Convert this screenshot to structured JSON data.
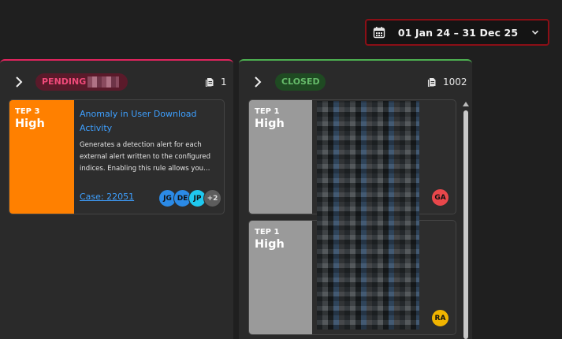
{
  "date_range": {
    "label": "01 Jan 24 – 31 Dec 25",
    "icon": "calendar-icon"
  },
  "columns": [
    {
      "status": "PENDING",
      "accent": "#e0245e",
      "count": "1",
      "cards": [
        {
          "step": "TEP 3",
          "severity": "High",
          "severity_color": "#ff8000",
          "title": "Anomaly in User Download Activity",
          "description": "Generates a detection alert for each external alert written to the configured indices. Enabling this rule allows you…",
          "case": "Case: 22051",
          "assignees": [
            "JG",
            "DE",
            "JP"
          ],
          "more_assignees": "+2"
        }
      ]
    },
    {
      "status": "CLOSED",
      "accent": "#4caf50",
      "count": "1002",
      "cards": [
        {
          "step": "TEP 1",
          "severity": "High",
          "severity_color": "#9a9a9a",
          "assignee": "GA"
        },
        {
          "step": "TEP 1",
          "severity": "High",
          "severity_color": "#9a9a9a",
          "assignee": "RA"
        }
      ]
    }
  ]
}
